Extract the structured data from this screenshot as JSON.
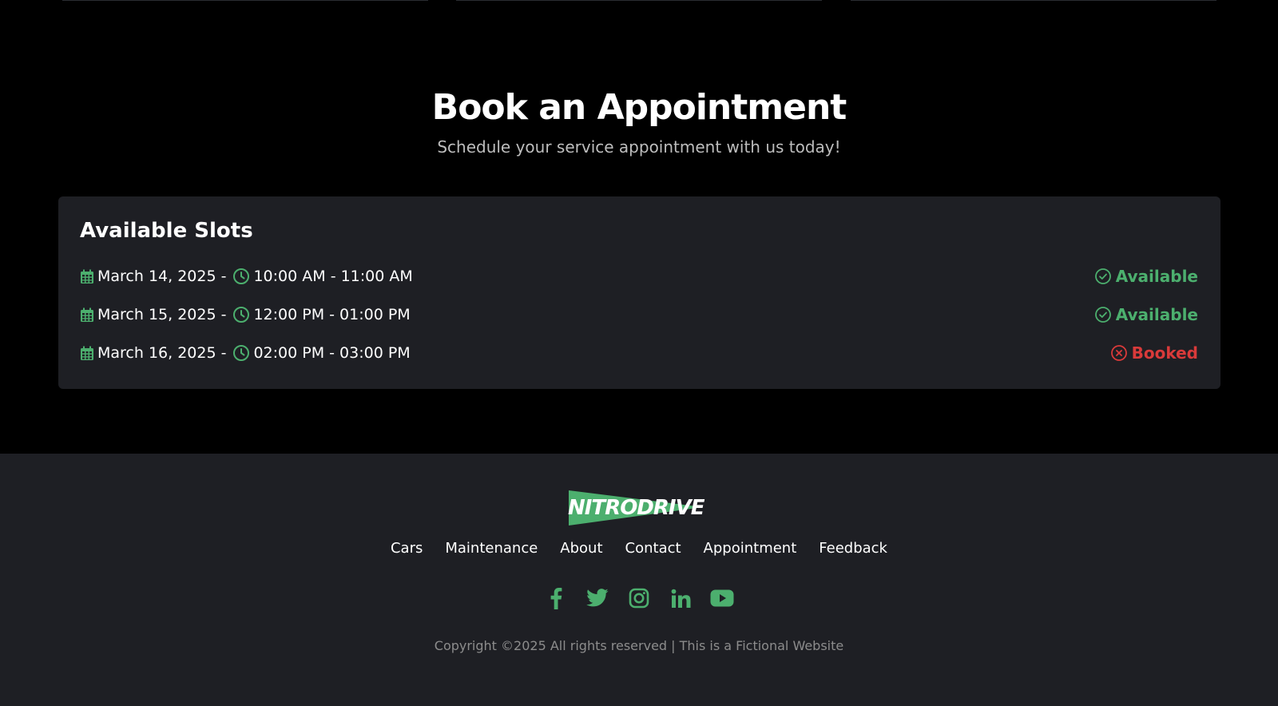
{
  "hero": {
    "title": "Book an Appointment",
    "subtitle": "Schedule your service appointment with us today!"
  },
  "slots": {
    "heading": "Available Slots",
    "items": [
      {
        "date": "March 14, 2025 -",
        "time": "10:00 AM - 11:00 AM",
        "status": "Available",
        "state": "available"
      },
      {
        "date": "March 15, 2025 -",
        "time": "12:00 PM - 01:00 PM",
        "status": "Available",
        "state": "available"
      },
      {
        "date": "March 16, 2025 -",
        "time": "02:00 PM - 03:00 PM",
        "status": "Booked",
        "state": "booked"
      }
    ]
  },
  "footer": {
    "logo": "NITRODRIVE",
    "nav": [
      "Cars",
      "Maintenance",
      "About",
      "Contact",
      "Appointment",
      "Feedback"
    ],
    "socials": [
      "facebook-icon",
      "twitter-icon",
      "instagram-icon",
      "linkedin-icon",
      "youtube-icon"
    ],
    "copyright": "Copyright ©2025 All rights reserved | This is a Fictional Website"
  },
  "colors": {
    "accent": "#4caf6e",
    "booked": "#d93a3a",
    "panel": "#1e1f24",
    "background": "#000000"
  }
}
